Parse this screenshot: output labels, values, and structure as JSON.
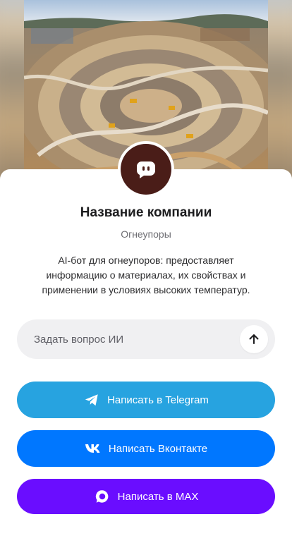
{
  "company": {
    "name": "Название компании",
    "category": "Огнеупоры",
    "description": "AI-бот для огнеупоров: предоставляет информацию о материалах, их свойствах и применении в условиях высоких температур."
  },
  "ask": {
    "placeholder": "Задать вопрос ИИ",
    "send_icon": "arrow-up-icon"
  },
  "buttons": {
    "telegram": {
      "label": "Написать в Telegram",
      "icon": "telegram-icon",
      "color": "#27A3E0"
    },
    "vk": {
      "label": "Написать Вконтакте",
      "icon": "vk-icon",
      "color": "#0077FF"
    },
    "max": {
      "label": "Написать в MAX",
      "icon": "max-messenger-icon",
      "color": "#6A0DFF"
    }
  },
  "avatar": {
    "icon": "chat-bot-icon",
    "color": "#4A1D18"
  }
}
